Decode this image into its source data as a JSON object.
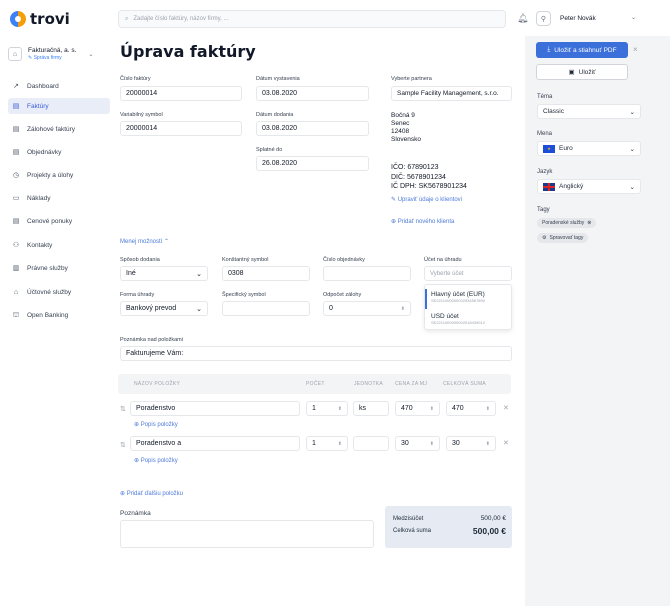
{
  "app": {
    "name": "trovi"
  },
  "search": {
    "placeholder": "Zadajte číslo faktúry, názov firmy, ..."
  },
  "user": {
    "name": "Peter Novák"
  },
  "company": {
    "name": "Fakturačná, a. s.",
    "manage": "Správa firmy"
  },
  "nav": [
    {
      "label": "Dashboard",
      "icon": "↗"
    },
    {
      "label": "Faktúry",
      "icon": "▤"
    },
    {
      "label": "Zálohové faktúry",
      "icon": "▤"
    },
    {
      "label": "Objednávky",
      "icon": "▤"
    },
    {
      "label": "Projekty a úlohy",
      "icon": "◷"
    },
    {
      "label": "Náklady",
      "icon": "▭"
    },
    {
      "label": "Cenové ponuky",
      "icon": "▤"
    },
    {
      "label": "Kontakty",
      "icon": "⚇"
    },
    {
      "label": "Právne služby",
      "icon": "▥"
    },
    {
      "label": "Účtovné služby",
      "icon": "⌂"
    },
    {
      "label": "Open Banking",
      "icon": "⛫"
    }
  ],
  "page": {
    "title": "Úprava faktúry"
  },
  "form": {
    "invoice_number": {
      "label": "Číslo faktúry",
      "value": "20000014"
    },
    "issue_date": {
      "label": "Dátum vystavenia",
      "value": "03.08.2020"
    },
    "variable_symbol": {
      "label": "Variabilný symbol",
      "value": "20000014"
    },
    "delivery_date": {
      "label": "Dátum dodania",
      "value": "03.08.2020"
    },
    "due_date": {
      "label": "Splatné do",
      "value": "26.08.2020"
    },
    "partner": {
      "label": "Vyberte partnera",
      "value": "Sample Facility Management, s.r.o."
    },
    "address": [
      "Bočná 9",
      "Senec",
      "12408",
      "Slovensko"
    ],
    "ids": [
      "IČO: 67890123",
      "DIČ: 5678901234",
      "IČ DPH: SK5678901234"
    ],
    "edit_client": "Upraviť údaje o klientovi",
    "add_client": "Pridať nového klienta",
    "less_options": "Menej možností",
    "delivery_method": {
      "label": "Spôsob dodania",
      "value": "Iné"
    },
    "constant_symbol": {
      "label": "Konštantný symbol",
      "value": "0308"
    },
    "order_number": {
      "label": "Číslo objednávky",
      "value": ""
    },
    "bank_account": {
      "label": "Účet na úhradu",
      "placeholder": "Vyberte účet"
    },
    "payment_method": {
      "label": "Forma úhrady",
      "value": "Bankový prevod"
    },
    "specific_symbol": {
      "label": "Špecifický symbol",
      "value": ""
    },
    "advance": {
      "label": "Odpočet zálohy",
      "value": "0"
    },
    "accounts": [
      {
        "name": "Hlavný účet (EUR)",
        "iban": "SK2211000000002934567890"
      },
      {
        "name": "USD účet",
        "iban": "SK2211000000002018439012"
      }
    ],
    "note_above": {
      "label": "Poznámka nad položkami",
      "value": "Fakturujeme Vám:"
    }
  },
  "items_table": {
    "headers": [
      "NÁZOV POLOŽKY",
      "POČET",
      "JEDNOTKA",
      "CENA ZA MJ",
      "CELKOVÁ SUMA"
    ],
    "rows": [
      {
        "name": "Poradenstvo",
        "qty": "1",
        "unit": "ks",
        "price": "470",
        "total": "470",
        "desc": "Popis položky"
      },
      {
        "name": "Poradenstvo a",
        "qty": "1",
        "unit": "",
        "price": "30",
        "total": "30",
        "desc": "Popis položky"
      }
    ],
    "add_item": "Pridať ďalšiu položku"
  },
  "note": {
    "label": "Poznámka"
  },
  "summary": {
    "subtotal_label": "Medzisúčet",
    "subtotal": "500,00 €",
    "total_label": "Celková suma",
    "total": "500,00 €"
  },
  "right": {
    "save_download": "Uložiť a stiahnuť PDF",
    "save": "Uložiť",
    "theme": {
      "label": "Téma",
      "value": "Classic"
    },
    "currency": {
      "label": "Mena",
      "value": "Euro"
    },
    "language": {
      "label": "Jazyk",
      "value": "Anglický"
    },
    "tags_label": "Tagy",
    "tags": [
      "Poradenské služby",
      "Spravovať tagy"
    ]
  },
  "colors": {
    "accent": "#3b6fd9",
    "active_nav": "#e8edf8"
  }
}
